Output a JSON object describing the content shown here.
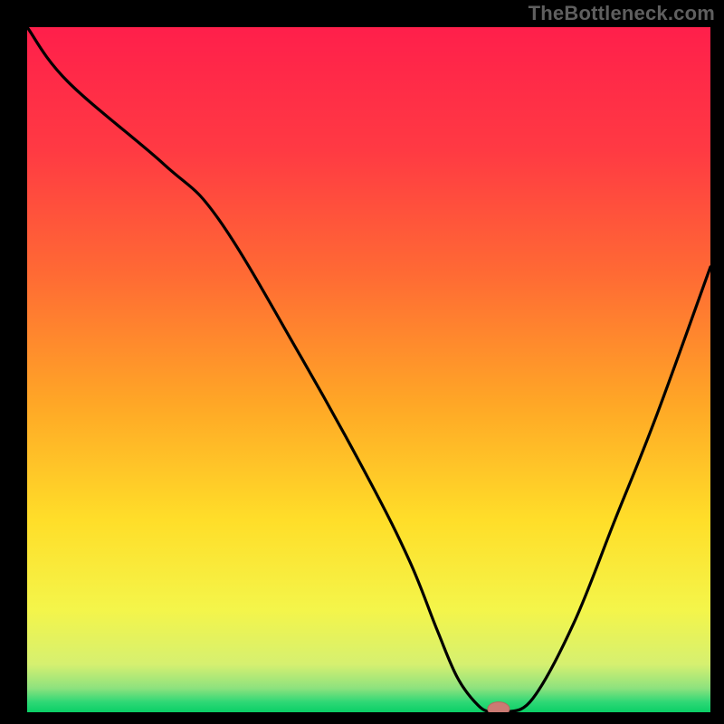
{
  "watermark": "TheBottleneck.com",
  "colors": {
    "black": "#000000",
    "gradient_stops": [
      {
        "offset": 0.0,
        "color": "#ff1f4b"
      },
      {
        "offset": 0.18,
        "color": "#ff3a43"
      },
      {
        "offset": 0.36,
        "color": "#ff6a34"
      },
      {
        "offset": 0.55,
        "color": "#ffa726"
      },
      {
        "offset": 0.72,
        "color": "#ffde29"
      },
      {
        "offset": 0.85,
        "color": "#f4f54a"
      },
      {
        "offset": 0.93,
        "color": "#d6f070"
      },
      {
        "offset": 0.965,
        "color": "#8de27e"
      },
      {
        "offset": 0.985,
        "color": "#2fd876"
      },
      {
        "offset": 1.0,
        "color": "#0acf66"
      }
    ],
    "curve": "#000000",
    "marker_fill": "#cb7a73",
    "marker_stroke": "#b9665f"
  },
  "chart_data": {
    "type": "line",
    "title": "",
    "xlabel": "",
    "ylabel": "",
    "xlim": [
      0,
      100
    ],
    "ylim": [
      0,
      100
    ],
    "series": [
      {
        "name": "bottleneck-curve",
        "x": [
          0,
          6,
          20,
          28,
          40,
          50,
          56,
          60,
          63,
          66,
          68,
          70,
          74,
          80,
          86,
          92,
          100
        ],
        "values": [
          100,
          92,
          80,
          72,
          52,
          34,
          22,
          12,
          5,
          1,
          0,
          0,
          2,
          13,
          28,
          43,
          65
        ]
      }
    ],
    "marker": {
      "x": 69,
      "y": 0.5,
      "rx_pct": 1.6,
      "ry_pct": 1.0
    }
  }
}
